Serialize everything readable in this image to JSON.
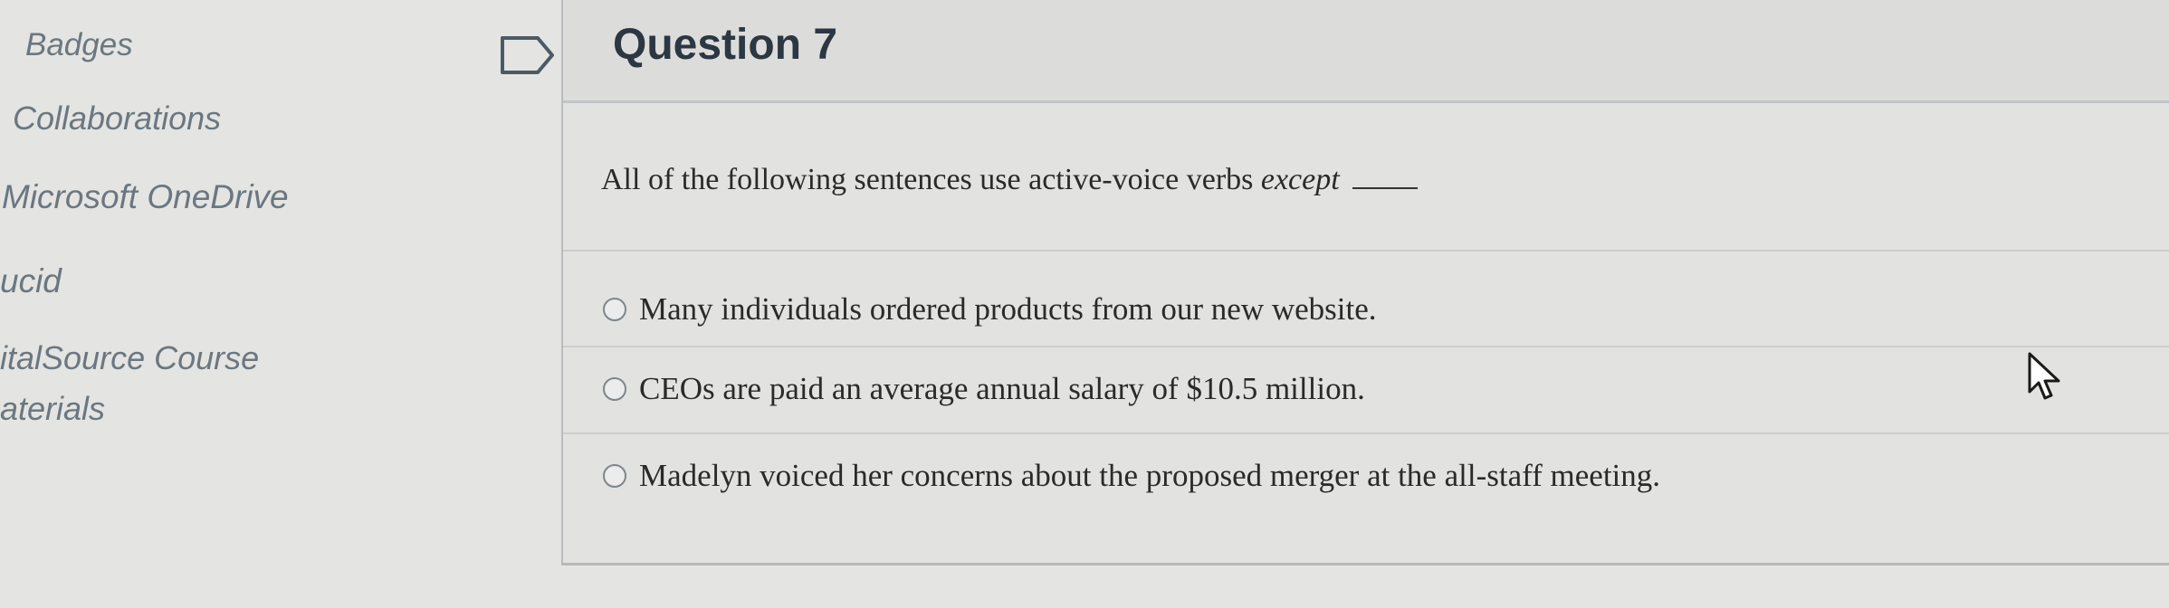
{
  "nav": {
    "items": [
      {
        "label": "Badges"
      },
      {
        "label": "Collaborations"
      },
      {
        "label": "Microsoft OneDrive"
      },
      {
        "label": "ucid"
      },
      {
        "label": "italSource Course"
      },
      {
        "label": "aterials"
      }
    ]
  },
  "question": {
    "title": "Question 7",
    "text_main": "All of the following sentences use active-voice verbs ",
    "text_emphasis": "except",
    "answers": [
      {
        "label": "Many individuals ordered products from our new website."
      },
      {
        "label": "CEOs are paid an average annual salary of $10.5 million."
      },
      {
        "label": "Madelyn voiced her concerns about the proposed merger at the all-staff meeting."
      }
    ]
  },
  "icons": {
    "flag": "flag-question-icon",
    "cursor": "mouse-pointer-icon"
  }
}
